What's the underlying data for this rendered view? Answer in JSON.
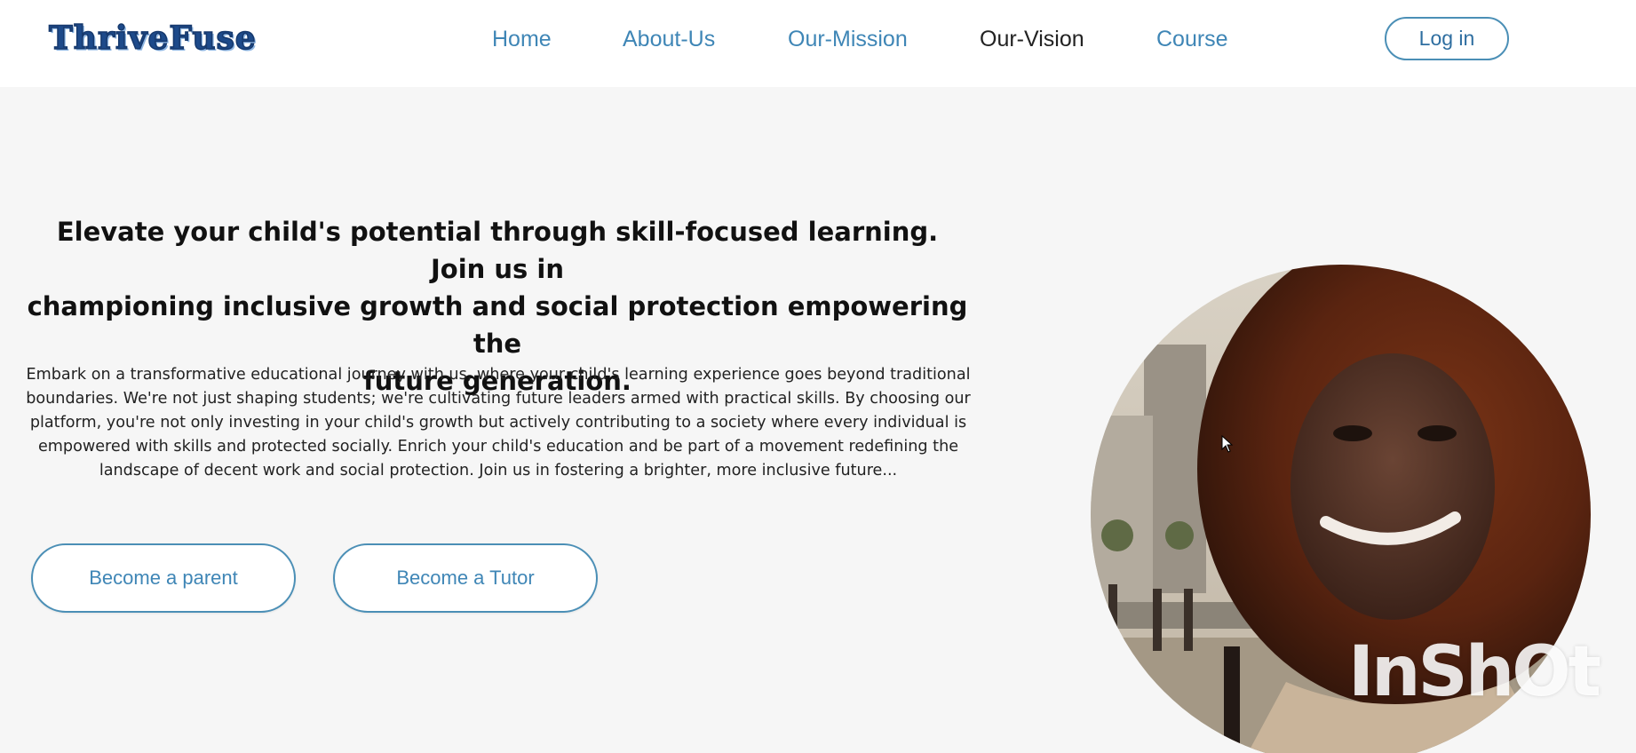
{
  "header": {
    "logo": "ThriveFuse",
    "nav": [
      {
        "label": "Home"
      },
      {
        "label": "About-Us"
      },
      {
        "label": "Our-Mission"
      },
      {
        "label": "Our-Vision"
      },
      {
        "label": "Course"
      }
    ],
    "login_label": "Log in"
  },
  "hero": {
    "headline_lines": [
      "Elevate your child's potential through skill-focused learning. Join us in",
      "championing inclusive growth and social protection empowering the",
      "future generation."
    ],
    "body_lines": [
      "Embark on a transformative educational journey with us, where your child's learning experience goes beyond traditional",
      "boundaries. We're not just shaping students; we're cultivating future leaders armed with practical skills. By choosing our",
      "platform, you're not only investing in your child's growth but actively contributing to a society where every individual is",
      "empowered with skills and protected socially. Enrich your child's education and be part of a movement redefining the",
      "landscape of decent work and social protection. Join us in fostering a brighter, more inclusive future..."
    ],
    "buttons": {
      "parent": "Become a parent",
      "tutor": "Become a Tutor"
    }
  },
  "watermark": "InShOt",
  "colors": {
    "accent": "#3f86b6",
    "active_nav": "#222222",
    "header_bg": "#ffffff",
    "page_bg": "#f6f6f6"
  }
}
